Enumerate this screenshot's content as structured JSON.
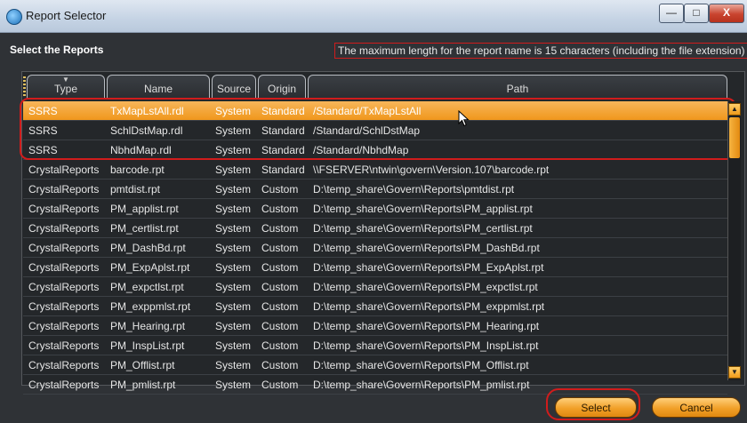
{
  "window": {
    "title": "Report Selector",
    "minimize": "—",
    "maximize": "□",
    "close": "X"
  },
  "header": {
    "label": "Select the Reports",
    "note": "The maximum length for the report name is 15 characters (including the file extension)"
  },
  "columns": [
    "Type",
    "Name",
    "Source",
    "Origin",
    "Path"
  ],
  "rows": [
    [
      "SSRS",
      "TxMapLstAll.rdl",
      "System",
      "Standard",
      "/Standard/TxMapLstAll"
    ],
    [
      "SSRS",
      "SchlDstMap.rdl",
      "System",
      "Standard",
      "/Standard/SchlDstMap"
    ],
    [
      "SSRS",
      "NbhdMap.rdl",
      "System",
      "Standard",
      "/Standard/NbhdMap"
    ],
    [
      "CrystalReports",
      "barcode.rpt",
      "System",
      "Standard",
      "\\\\FSERVER\\ntwin\\govern\\Version.107\\barcode.rpt"
    ],
    [
      "CrystalReports",
      "pmtdist.rpt",
      "System",
      "Custom",
      "D:\\temp_share\\Govern\\Reports\\pmtdist.rpt"
    ],
    [
      "CrystalReports",
      "PM_applist.rpt",
      "System",
      "Custom",
      "D:\\temp_share\\Govern\\Reports\\PM_applist.rpt"
    ],
    [
      "CrystalReports",
      "PM_certlist.rpt",
      "System",
      "Custom",
      "D:\\temp_share\\Govern\\Reports\\PM_certlist.rpt"
    ],
    [
      "CrystalReports",
      "PM_DashBd.rpt",
      "System",
      "Custom",
      "D:\\temp_share\\Govern\\Reports\\PM_DashBd.rpt"
    ],
    [
      "CrystalReports",
      "PM_ExpAplst.rpt",
      "System",
      "Custom",
      "D:\\temp_share\\Govern\\Reports\\PM_ExpAplst.rpt"
    ],
    [
      "CrystalReports",
      "PM_expctlst.rpt",
      "System",
      "Custom",
      "D:\\temp_share\\Govern\\Reports\\PM_expctlst.rpt"
    ],
    [
      "CrystalReports",
      "PM_exppmlst.rpt",
      "System",
      "Custom",
      "D:\\temp_share\\Govern\\Reports\\PM_exppmlst.rpt"
    ],
    [
      "CrystalReports",
      "PM_Hearing.rpt",
      "System",
      "Custom",
      "D:\\temp_share\\Govern\\Reports\\PM_Hearing.rpt"
    ],
    [
      "CrystalReports",
      "PM_InspList.rpt",
      "System",
      "Custom",
      "D:\\temp_share\\Govern\\Reports\\PM_InspList.rpt"
    ],
    [
      "CrystalReports",
      "PM_Offlist.rpt",
      "System",
      "Custom",
      "D:\\temp_share\\Govern\\Reports\\PM_Offlist.rpt"
    ],
    [
      "CrystalReports",
      "PM_pmlist.rpt",
      "System",
      "Custom",
      "D:\\temp_share\\Govern\\Reports\\PM_pmlist.rpt"
    ]
  ],
  "selected_row": 0,
  "buttons": {
    "select": "Select",
    "cancel": "Cancel"
  },
  "colors": {
    "accent": "#f0971c",
    "annotation": "#d01c1c",
    "background": "#2f3236"
  }
}
